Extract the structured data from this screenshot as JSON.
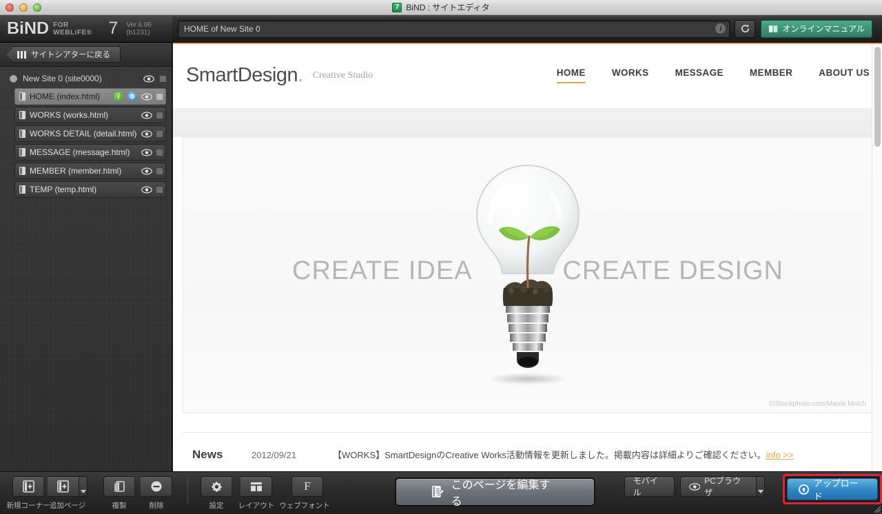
{
  "window": {
    "title": "BiND : サイトエディタ",
    "title_icon": "bind-app-icon",
    "title_icon_label": "7"
  },
  "toolbar": {
    "brand_name": "BiND",
    "brand_sub": "FOR WEBLiFE®",
    "brand_version_number": "7",
    "version": "Ver.6.86 (b1231)",
    "address_value": "HOME of New Site 0",
    "info_icon": "i",
    "reload_icon": "↻",
    "manual_label": "オンラインマニュアル"
  },
  "sidebar": {
    "back_label": "サイトシアターに戻る",
    "site": {
      "label": "New Site 0 (site0000)"
    },
    "pages": [
      {
        "label": "HOME (index.html)",
        "selected": true,
        "has_info": true,
        "has_gear": true
      },
      {
        "label": "WORKS (works.html)",
        "selected": false,
        "has_info": false,
        "has_gear": false
      },
      {
        "label": "WORKS DETAIL (detail.html)",
        "selected": false,
        "has_info": false,
        "has_gear": false
      },
      {
        "label": "MESSAGE (message.html)",
        "selected": false,
        "has_info": false,
        "has_gear": false
      },
      {
        "label": "MEMBER (member.html)",
        "selected": false,
        "has_info": false,
        "has_gear": false
      },
      {
        "label": "TEMP (temp.html)",
        "selected": false,
        "has_info": false,
        "has_gear": false
      }
    ]
  },
  "preview": {
    "logo": "SmartDesign",
    "logo_dot": ".",
    "tagline": "Creative Studio",
    "nav": [
      {
        "label": "HOME",
        "active": true
      },
      {
        "label": "WORKS",
        "active": false
      },
      {
        "label": "MESSAGE",
        "active": false
      },
      {
        "label": "MEMBER",
        "active": false
      },
      {
        "label": "ABOUT US",
        "active": false
      }
    ],
    "hero_left": "CREATE IDEA",
    "hero_right": "CREATE DESIGN",
    "hero_credit": "©iStockphoto.com/Marek Mnich",
    "news_heading": "News",
    "news_date": "2012/09/21",
    "news_body": "【WORKS】SmartDesignのCreative Works活動情報を更新しました。掲載内容は詳細よりご確認ください。",
    "news_link": "info >>"
  },
  "bottombar": {
    "new_corner": "新規コーナー",
    "add_page": "追加ページ",
    "duplicate": "複製",
    "delete": "削除",
    "settings": "設定",
    "layout": "レイアウト",
    "webfont": "ウェブフォント",
    "webfont_glyph": "F",
    "edit_page": "このページを編集する",
    "mobile": "モバイル",
    "pc_browser": "PCブラウザ",
    "upload": "アップロード"
  },
  "colors": {
    "accent_orange": "#f0a33c",
    "manual_green": "#3f9a7c",
    "upload_blue": "#2e86c4",
    "highlight_red": "#e8222a"
  }
}
